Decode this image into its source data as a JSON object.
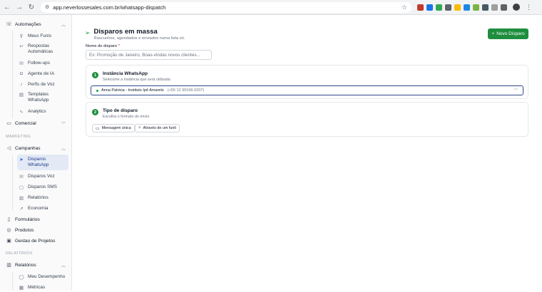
{
  "browser": {
    "url": "app.neverlossesales.com.br/whatsapp-dispatch"
  },
  "sidebar": {
    "automacoes": {
      "label": "Automações",
      "items": [
        {
          "label": "Meus Funis",
          "icon": "funnel-icon"
        },
        {
          "label": "Respostas Automáticas",
          "icon": "reply-icon"
        },
        {
          "label": "Follow-ups",
          "icon": "phone-icon"
        },
        {
          "label": "Agente de IA",
          "icon": "robot-icon"
        },
        {
          "label": "Perfis de Voz",
          "icon": "mic-icon"
        },
        {
          "label": "Templates WhatsApp",
          "icon": "template-icon"
        },
        {
          "label": "Analytics",
          "icon": "analytics-icon"
        }
      ]
    },
    "comercial": {
      "label": "Comercial"
    },
    "section_marketing": "MARKETING",
    "campanhas": {
      "label": "Campanhas",
      "items": [
        {
          "label": "Disparos WhatsApp",
          "icon": "send-icon",
          "active": true
        },
        {
          "label": "Disparos Voz",
          "icon": "phone-icon"
        },
        {
          "label": "Disparos SMS",
          "icon": "sms-icon"
        },
        {
          "label": "Relatórios",
          "icon": "report-icon"
        },
        {
          "label": "Economia",
          "icon": "trend-icon"
        }
      ]
    },
    "formularios": {
      "label": "Formulários"
    },
    "produtos": {
      "label": "Produtos"
    },
    "gestao": {
      "label": "Gestao de Projetos"
    },
    "section_relatorios": "RELATÓRIOS",
    "relatorios": {
      "label": "Relatórios",
      "items": [
        {
          "label": "Meu Desempenho",
          "icon": "user-icon"
        },
        {
          "label": "Métricas",
          "icon": "metrics-icon"
        }
      ]
    }
  },
  "main": {
    "title": "Disparos em massa",
    "subtitle": "Rascunhos, agendados e enviados numa lista só.",
    "new_button": "Novo Disparo",
    "name_field": {
      "label": "Nome do disparo",
      "required_mark": "*",
      "placeholder": "Ex: Promoção de Janeiro, Boas-vindas novos clientes..."
    },
    "step1": {
      "number": "1",
      "title": "Instância WhatsApp",
      "subtitle": "Selecione a instância que será utilizada",
      "selected_instance": "Anna Patricia - Instituto Ipê Amarelo",
      "selected_phone": "(+55 12 99196-5207)"
    },
    "step2": {
      "number": "2",
      "title": "Tipo de disparo",
      "subtitle": "Escolha o formato do envio",
      "option_single": "Mensagem única",
      "option_funnel": "Através de um funil"
    }
  }
}
